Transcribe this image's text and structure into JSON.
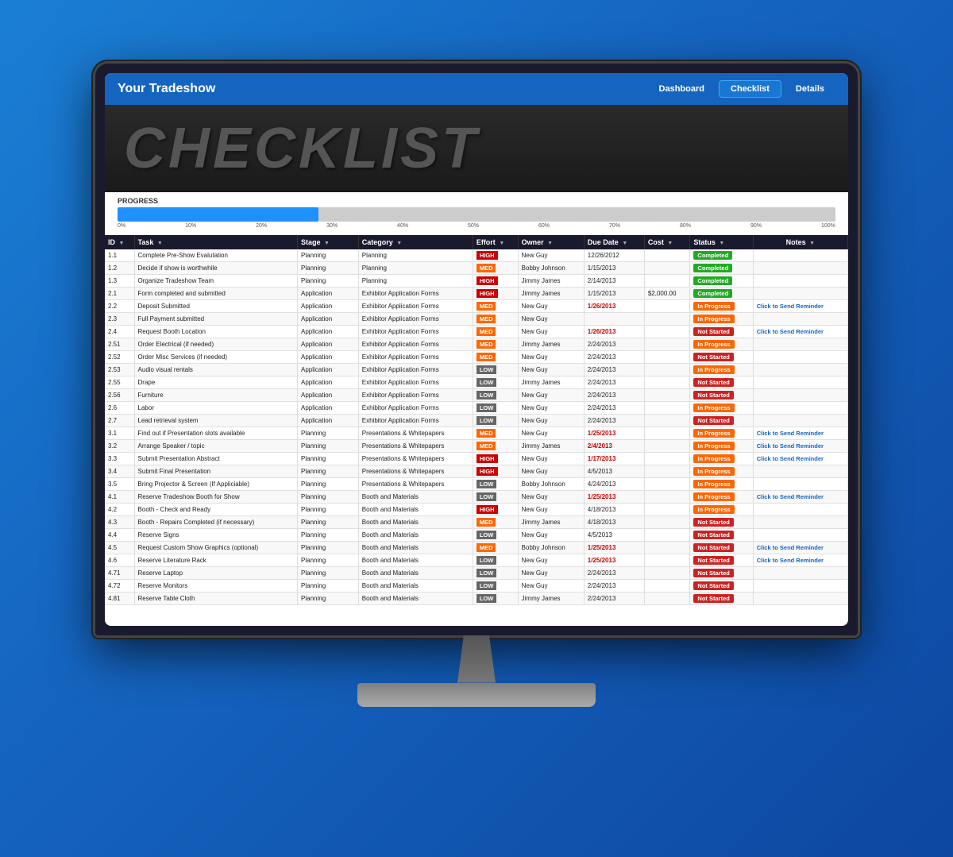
{
  "app": {
    "title": "Your Tradeshow",
    "nav": [
      {
        "label": "Dashboard",
        "active": false
      },
      {
        "label": "Checklist",
        "active": true
      },
      {
        "label": "Details",
        "active": false
      }
    ]
  },
  "page": {
    "title": "CHECKLIST",
    "progress_label": "PROGRESS",
    "progress_percent": 28,
    "progress_ticks": [
      "0%",
      "10%",
      "20%",
      "30%",
      "40%",
      "50%",
      "60%",
      "70%",
      "80%",
      "90%",
      "100%"
    ]
  },
  "table": {
    "headers": [
      "ID",
      "Task",
      "Stage",
      "Category",
      "Effort",
      "Owner",
      "Due Date",
      "Cost",
      "Status",
      "Notes"
    ],
    "rows": [
      {
        "id": "1.1",
        "task": "Complete Pre-Show Evalutation",
        "stage": "Planning",
        "category": "Planning",
        "effort": "HIGH",
        "owner": "New Guy",
        "due": "12/26/2012",
        "cost": "",
        "status": "Completed",
        "note": ""
      },
      {
        "id": "1.2",
        "task": "Decide if show is worthwhile",
        "stage": "Planning",
        "category": "Planning",
        "effort": "MED",
        "owner": "Bobby Johnson",
        "due": "1/15/2013",
        "cost": "",
        "status": "Completed",
        "note": ""
      },
      {
        "id": "1.3",
        "task": "Organize Tradeshow Team",
        "stage": "Planning",
        "category": "Planning",
        "effort": "HIGH",
        "owner": "Jimmy James",
        "due": "2/14/2013",
        "cost": "",
        "status": "Completed",
        "note": ""
      },
      {
        "id": "2.1",
        "task": "Form completed and submitted",
        "stage": "Application",
        "category": "Exhibitor Application Forms",
        "effort": "HIGH",
        "owner": "Jimmy James",
        "due": "1/15/2013",
        "cost": "$2,000.00",
        "status": "Completed",
        "note": ""
      },
      {
        "id": "2.2",
        "task": "Deposit Submitted",
        "stage": "Application",
        "category": "Exhibitor Application Forms",
        "effort": "MED",
        "owner": "New Guy",
        "due": "1/26/2013",
        "cost": "",
        "status": "In Progress",
        "note": "Click to Send Reminder"
      },
      {
        "id": "2.3",
        "task": "Full Payment submitted",
        "stage": "Application",
        "category": "Exhibitor Application Forms",
        "effort": "MED",
        "owner": "New Guy",
        "due": "",
        "cost": "",
        "status": "In Progress",
        "note": ""
      },
      {
        "id": "2.4",
        "task": "Request Booth Location",
        "stage": "Application",
        "category": "Exhibitor Application Forms",
        "effort": "MED",
        "owner": "New Guy",
        "due": "1/26/2013",
        "cost": "",
        "status": "Not Started",
        "note": "Click to Send Reminder"
      },
      {
        "id": "2.51",
        "task": "Order Electrical (if needed)",
        "stage": "Application",
        "category": "Exhibitor Application Forms",
        "effort": "MED",
        "owner": "Jimmy James",
        "due": "2/24/2013",
        "cost": "",
        "status": "In Progress",
        "note": ""
      },
      {
        "id": "2.52",
        "task": "Order Misc Services (if needed)",
        "stage": "Application",
        "category": "Exhibitor Application Forms",
        "effort": "MED",
        "owner": "New Guy",
        "due": "2/24/2013",
        "cost": "",
        "status": "Not Started",
        "note": ""
      },
      {
        "id": "2.53",
        "task": "Audio visual rentals",
        "stage": "Application",
        "category": "Exhibitor Application Forms",
        "effort": "LOW",
        "owner": "New Guy",
        "due": "2/24/2013",
        "cost": "",
        "status": "In Progress",
        "note": ""
      },
      {
        "id": "2.55",
        "task": "Drape",
        "stage": "Application",
        "category": "Exhibitor Application Forms",
        "effort": "LOW",
        "owner": "Jimmy James",
        "due": "2/24/2013",
        "cost": "",
        "status": "Not Started",
        "note": ""
      },
      {
        "id": "2.56",
        "task": "Furniture",
        "stage": "Application",
        "category": "Exhibitor Application Forms",
        "effort": "LOW",
        "owner": "New Guy",
        "due": "2/24/2013",
        "cost": "",
        "status": "Not Started",
        "note": ""
      },
      {
        "id": "2.6",
        "task": "Labor",
        "stage": "Application",
        "category": "Exhibitor Application Forms",
        "effort": "LOW",
        "owner": "New Guy",
        "due": "2/24/2013",
        "cost": "",
        "status": "In Progress",
        "note": ""
      },
      {
        "id": "2.7",
        "task": "Lead retrieval system",
        "stage": "Application",
        "category": "Exhibitor Application Forms",
        "effort": "LOW",
        "owner": "New Guy",
        "due": "2/24/2013",
        "cost": "",
        "status": "Not Started",
        "note": ""
      },
      {
        "id": "3.1",
        "task": "Find out if Presentation slots available",
        "stage": "Planning",
        "category": "Presentations & Whitepapers",
        "effort": "MED",
        "owner": "New Guy",
        "due": "1/25/2013",
        "cost": "",
        "status": "In Progress",
        "note": "Click to Send Reminder"
      },
      {
        "id": "3.2",
        "task": "Arrange Speaker / topic",
        "stage": "Planning",
        "category": "Presentations & Whitepapers",
        "effort": "MED",
        "owner": "Jimmy James",
        "due": "2/4/2013",
        "cost": "",
        "status": "In Progress",
        "note": "Click to Send Reminder"
      },
      {
        "id": "3.3",
        "task": "Submit Presentation Abstract",
        "stage": "Planning",
        "category": "Presentations & Whitepapers",
        "effort": "HIGH",
        "owner": "New Guy",
        "due": "1/17/2013",
        "cost": "",
        "status": "In Progress",
        "note": "Click to Send Reminder"
      },
      {
        "id": "3.4",
        "task": "Submit Final Presentation",
        "stage": "Planning",
        "category": "Presentations & Whitepapers",
        "effort": "HIGH",
        "owner": "New Guy",
        "due": "4/5/2013",
        "cost": "",
        "status": "In Progress",
        "note": ""
      },
      {
        "id": "3.5",
        "task": "Bring Projector & Screen (If Appliciable)",
        "stage": "Planning",
        "category": "Presentations & Whitepapers",
        "effort": "LOW",
        "owner": "Bobby Johnson",
        "due": "4/24/2013",
        "cost": "",
        "status": "In Progress",
        "note": ""
      },
      {
        "id": "4.1",
        "task": "Reserve Tradeshow Booth for Show",
        "stage": "Planning",
        "category": "Booth and Materials",
        "effort": "LOW",
        "owner": "New Guy",
        "due": "1/25/2013",
        "cost": "",
        "status": "In Progress",
        "note": "Click to Send Reminder"
      },
      {
        "id": "4.2",
        "task": "Booth - Check and Ready",
        "stage": "Planning",
        "category": "Booth and Materials",
        "effort": "HIGH",
        "owner": "New Guy",
        "due": "4/18/2013",
        "cost": "",
        "status": "In Progress",
        "note": ""
      },
      {
        "id": "4.3",
        "task": "Booth - Repairs Completed (if necessary)",
        "stage": "Planning",
        "category": "Booth and Materials",
        "effort": "MED",
        "owner": "Jimmy James",
        "due": "4/18/2013",
        "cost": "",
        "status": "Not Started",
        "note": ""
      },
      {
        "id": "4.4",
        "task": "Reserve Signs",
        "stage": "Planning",
        "category": "Booth and Materials",
        "effort": "LOW",
        "owner": "New Guy",
        "due": "4/5/2013",
        "cost": "",
        "status": "Not Started",
        "note": ""
      },
      {
        "id": "4.5",
        "task": "Request Custom Show Graphics (optional)",
        "stage": "Planning",
        "category": "Booth and Materials",
        "effort": "MED",
        "owner": "Bobby Johnson",
        "due": "1/25/2013",
        "cost": "",
        "status": "Not Started",
        "note": "Click to Send Reminder"
      },
      {
        "id": "4.6",
        "task": "Reserve Literature Rack",
        "stage": "Planning",
        "category": "Booth and Materials",
        "effort": "LOW",
        "owner": "New Guy",
        "due": "1/25/2013",
        "cost": "",
        "status": "Not Started",
        "note": "Click to Send Reminder"
      },
      {
        "id": "4.71",
        "task": "Reserve Laptop",
        "stage": "Planning",
        "category": "Booth and Materials",
        "effort": "LOW",
        "owner": "New Guy",
        "due": "2/24/2013",
        "cost": "",
        "status": "Not Started",
        "note": ""
      },
      {
        "id": "4.72",
        "task": "Reserve Monitors",
        "stage": "Planning",
        "category": "Booth and Materials",
        "effort": "LOW",
        "owner": "New Guy",
        "due": "2/24/2013",
        "cost": "",
        "status": "Not Started",
        "note": ""
      },
      {
        "id": "4.81",
        "task": "Reserve Table Cloth",
        "stage": "Planning",
        "category": "Booth and Materials",
        "effort": "LOW",
        "owner": "Jimmy James",
        "due": "2/24/2013",
        "cost": "",
        "status": "Not Started",
        "note": ""
      }
    ]
  }
}
